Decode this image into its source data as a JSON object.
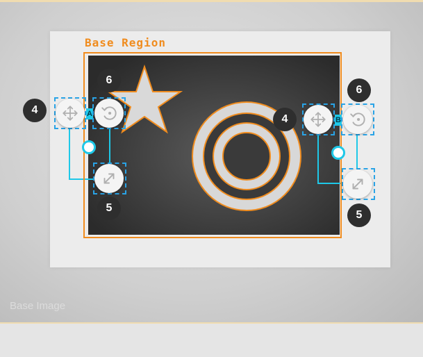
{
  "region": {
    "label": "Base Region"
  },
  "base_image": {
    "label": "Base Image"
  },
  "colors": {
    "region": "#f08c1e",
    "selection": "#29a3e6",
    "connector": "#1ec8e8",
    "badge": "#2e2e2e"
  },
  "handles": {
    "a": {
      "tag": "A",
      "move_badge": "4",
      "rotate_badge": "6",
      "resize_badge": "5"
    },
    "b": {
      "tag": "B",
      "move_badge": "4",
      "rotate_badge": "6",
      "resize_badge": "5"
    }
  },
  "icons": {
    "move": "move-arrows-icon",
    "rotate": "rotate-icon",
    "resize": "resize-diagonal-icon"
  }
}
